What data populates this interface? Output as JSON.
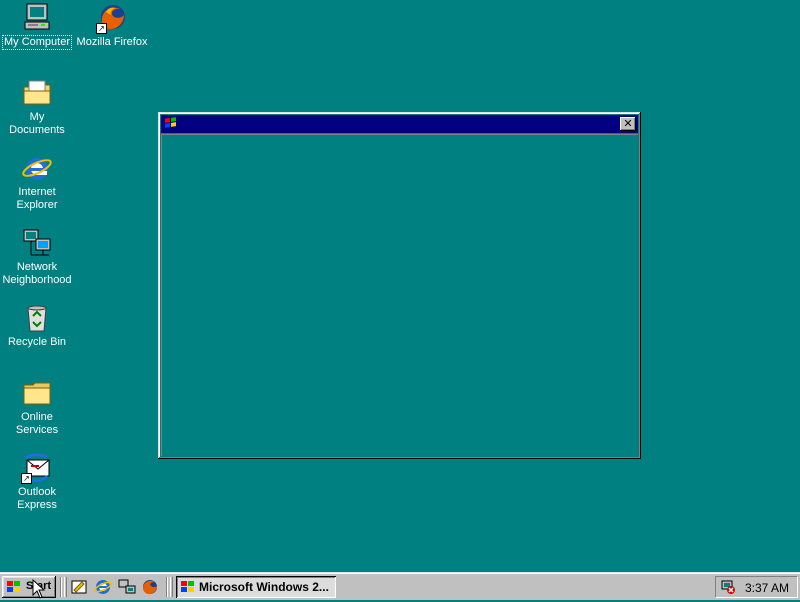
{
  "desktop": {
    "icons": [
      {
        "label": "My Computer",
        "icon": "my-computer-icon"
      },
      {
        "label": "Mozilla Firefox",
        "icon": "firefox-icon"
      },
      {
        "label": "My Documents",
        "icon": "my-documents-icon"
      },
      {
        "label": "Internet\nExplorer",
        "icon": "internet-explorer-icon"
      },
      {
        "label": "Network\nNeighborhood",
        "icon": "network-neighborhood-icon"
      },
      {
        "label": "Recycle Bin",
        "icon": "recycle-bin-icon"
      },
      {
        "label": "Online\nServices",
        "icon": "folder-icon"
      },
      {
        "label": "Outlook\nExpress",
        "icon": "outlook-express-icon"
      }
    ],
    "background_color": "#008080"
  },
  "window": {
    "title": "",
    "close_glyph": "✕",
    "titlebar_color": "#000080"
  },
  "taskbar": {
    "start_label": "Start",
    "task_button_label": "Microsoft Windows 2...",
    "clock": "3:37 AM",
    "quick_launch": [
      "show-desktop-icon",
      "internet-explorer-icon",
      "network-icon",
      "firefox-icon"
    ]
  }
}
